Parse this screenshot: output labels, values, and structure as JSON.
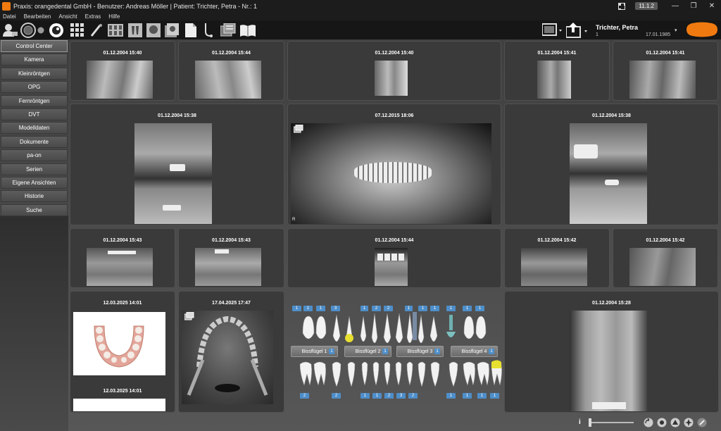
{
  "titlebar": {
    "title": "Praxis: orangedental GmbH - Benutzer: Andreas Möller  |  Patient: Trichter, Petra - Nr.: 1",
    "version": "11.1.2",
    "minimize": "—",
    "maximize": "❐",
    "close": "✕"
  },
  "menu": [
    "Datei",
    "Bearbeiten",
    "Ansicht",
    "Extras",
    "Hilfe"
  ],
  "patient": {
    "name": "Trichter, Petra",
    "number": "1",
    "dob": "17.01.1985",
    "caret": "▾"
  },
  "sidebar": [
    {
      "label": "Control Center",
      "active": true
    },
    {
      "label": "Kamera"
    },
    {
      "label": "Kleinröntgen"
    },
    {
      "label": "OPG"
    },
    {
      "label": "Fernröntgen"
    },
    {
      "label": "DVT"
    },
    {
      "label": "Modelldaten"
    },
    {
      "label": "Dokumente"
    },
    {
      "label": "pa-on"
    },
    {
      "label": "Serien"
    },
    {
      "label": "Eigene Ansichten"
    },
    {
      "label": "Historie"
    },
    {
      "label": "Suche"
    }
  ],
  "cards": [
    {
      "date": "01.12.2004 15:40"
    },
    {
      "date": "01.12.2004 15:44"
    },
    {
      "date": "01.12.2004 15:40"
    },
    {
      "date": "01.12.2004 15:41"
    },
    {
      "date": "01.12.2004 15:41"
    },
    {
      "date": "01.12.2004 15:38"
    },
    {
      "date": "07.12.2015 18:06"
    },
    {
      "date": "01.12.2004 15:38"
    },
    {
      "date": "01.12.2004 15:43"
    },
    {
      "date": "01.12.2004 15:43"
    },
    {
      "date": "01.12.2004 15:44"
    },
    {
      "date": "01.12.2004 15:42"
    },
    {
      "date": "01.12.2004 15:42"
    },
    {
      "date": "12.03.2025 14:01",
      "date2": "12.03.2025 14:01"
    },
    {
      "date": "17.04.2025 17:47"
    },
    {
      "date": "01.12.2004 15:28"
    }
  ],
  "opg_marker": "R",
  "chart": {
    "upper_badges": [
      "1",
      "1",
      "1",
      "3",
      "1",
      "2",
      "2",
      "1",
      "1",
      "1",
      "1",
      "1",
      "1"
    ],
    "lower_badges": [
      "2",
      "2",
      "1",
      "1",
      "2",
      "3",
      "2",
      "1",
      "1",
      "1",
      "1"
    ],
    "bite_buttons": [
      {
        "label": "Bissflügel 1",
        "n": "1"
      },
      {
        "label": "Bissflügel 2",
        "n": "1"
      },
      {
        "label": "Bissflügel 3",
        "n": "1"
      },
      {
        "label": "Bissflügel 4",
        "n": "1"
      }
    ]
  },
  "bottom": {
    "info": "i"
  },
  "colors": {
    "accent": "#f07a10",
    "badge": "#4e8ec9",
    "filling": "#e8e030"
  }
}
